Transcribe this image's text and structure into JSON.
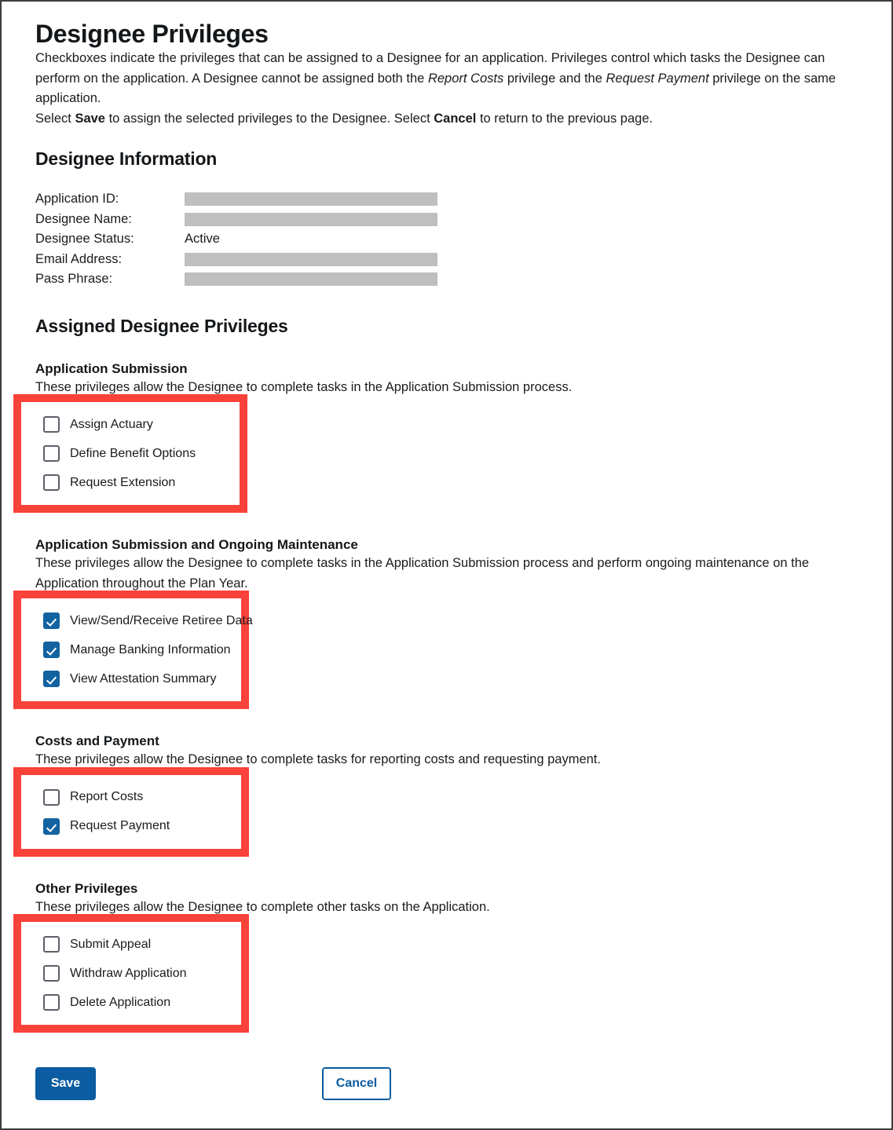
{
  "page": {
    "title": "Designee Privileges",
    "intro_paragraph_1": {
      "part1": "Checkboxes indicate the privileges that can be assigned to a Designee for an application. Privileges control which tasks the Designee can perform on the application. A Designee cannot be assigned both the ",
      "italic1": "Report Costs",
      "part2": " privilege and the ",
      "italic2": "Request Payment",
      "part3": " privilege on the same application."
    },
    "intro_paragraph_2": {
      "part1": "Select ",
      "bold1": "Save",
      "part2": " to assign the selected privileges to the Designee. Select ",
      "bold2": "Cancel",
      "part3": " to return to the previous page."
    }
  },
  "designee_information": {
    "heading": "Designee Information",
    "rows": [
      {
        "label": "Application ID:",
        "value": "",
        "redacted": true
      },
      {
        "label": "Designee Name:",
        "value": "",
        "redacted": true
      },
      {
        "label": "Designee Status:",
        "value": "Active",
        "redacted": false
      },
      {
        "label": "Email Address:",
        "value": "",
        "redacted": true
      },
      {
        "label": "Pass Phrase:",
        "value": "",
        "redacted": true
      }
    ]
  },
  "assigned_privileges": {
    "heading": "Assigned Designee Privileges",
    "groups": [
      {
        "title": "Application Submission",
        "description": "These privileges allow the Designee to complete tasks in the Application Submission process.",
        "items": [
          {
            "label": "Assign Actuary",
            "checked": false
          },
          {
            "label": "Define Benefit Options",
            "checked": false
          },
          {
            "label": "Request Extension",
            "checked": false
          }
        ]
      },
      {
        "title": "Application Submission and Ongoing Maintenance",
        "description": "These privileges allow the Designee to complete tasks in the Application Submission process and perform ongoing maintenance on the Application throughout the Plan Year.",
        "items": [
          {
            "label": "View/Send/Receive Retiree Data",
            "checked": true
          },
          {
            "label": "Manage Banking Information",
            "checked": true
          },
          {
            "label": "View Attestation Summary",
            "checked": true
          }
        ]
      },
      {
        "title": "Costs and Payment",
        "description": "These privileges allow the Designee to complete tasks for reporting costs and requesting payment.",
        "items": [
          {
            "label": "Report Costs",
            "checked": false
          },
          {
            "label": "Request Payment",
            "checked": true
          }
        ]
      },
      {
        "title": "Other Privileges",
        "description": "These privileges allow the Designee to complete other tasks on the Application.",
        "items": [
          {
            "label": "Submit Appeal",
            "checked": false
          },
          {
            "label": "Withdraw Application",
            "checked": false
          },
          {
            "label": "Delete Application",
            "checked": false
          }
        ]
      }
    ]
  },
  "actions": {
    "save_label": "Save",
    "cancel_label": "Cancel"
  },
  "colors": {
    "annotation_red": "#f9423a",
    "primary_blue": "#0b5ca0",
    "checkbox_blue": "#1263a0",
    "redaction_gray": "#bfbfbf",
    "page_border": "#3d3d3d"
  }
}
